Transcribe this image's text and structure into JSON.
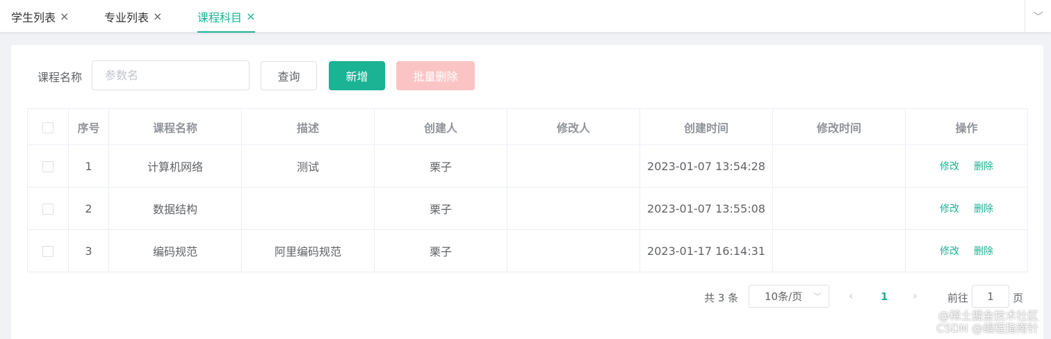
{
  "tabs": [
    {
      "label": "学生列表",
      "close": "×"
    },
    {
      "label": "专业列表",
      "close": "×"
    },
    {
      "label": "课程科目",
      "close": "×"
    }
  ],
  "tabs_more": "﹀",
  "toolbar": {
    "label": "课程名称",
    "search_placeholder": "参数名",
    "query_label": "查询",
    "add_label": "新增",
    "batch_delete_label": "批量删除"
  },
  "table": {
    "headers": [
      "序号",
      "课程名称",
      "描述",
      "创建人",
      "修改人",
      "创建时间",
      "修改时间",
      "操作"
    ],
    "rows": [
      {
        "index": "1",
        "name": "计算机网络",
        "desc": "测试",
        "creator": "栗子",
        "modifier": "",
        "created": "2023-01-07 13:54:28",
        "modified": "",
        "edit": "修改",
        "delete": "删除"
      },
      {
        "index": "2",
        "name": "数据结构",
        "desc": "",
        "creator": "栗子",
        "modifier": "",
        "created": "2023-01-07 13:55:08",
        "modified": "",
        "edit": "修改",
        "delete": "删除"
      },
      {
        "index": "3",
        "name": "编码规范",
        "desc": "阿里编码规范",
        "creator": "栗子",
        "modifier": "",
        "created": "2023-01-17 16:14:31",
        "modified": "",
        "edit": "修改",
        "delete": "删除"
      }
    ]
  },
  "pagination": {
    "total": "共 3 条",
    "page_size": "10条/页",
    "current_page": "1",
    "goto_label": "前往",
    "goto_value": "1",
    "page_suffix": "页"
  },
  "watermark": {
    "line1": "@稀土掘金技术社区",
    "line2": "CSDN @编程指南针"
  },
  "colors": {
    "accent": "#1ab394",
    "danger_disabled": "#fbc4c4"
  }
}
